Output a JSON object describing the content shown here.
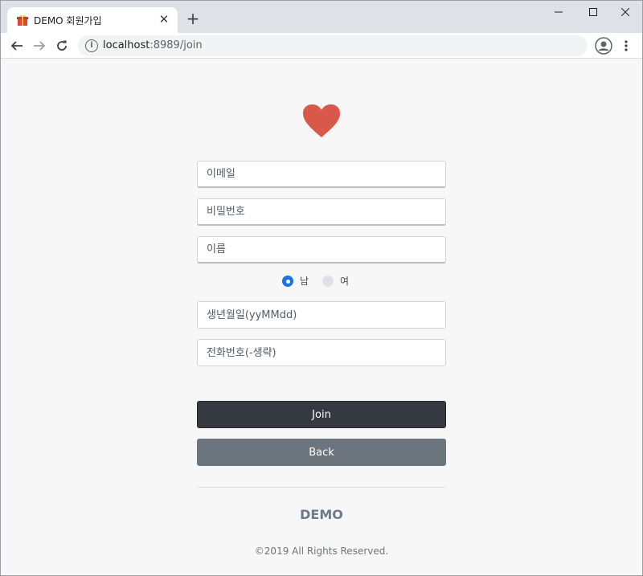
{
  "browser": {
    "tab_title": "DEMO 회원가입",
    "tab_close": "✕",
    "new_tab": "+",
    "url_host": "localhost",
    "url_rest": ":8989/join",
    "icons": [
      "gift-favicon-icon",
      "close-icon",
      "plus-icon",
      "minimize-icon",
      "maximize-icon",
      "close-window-icon",
      "back-arrow-icon",
      "forward-arrow-icon",
      "reload-icon",
      "info-icon",
      "profile-icon",
      "more-menu-icon"
    ]
  },
  "form": {
    "email_placeholder": "이메일",
    "password_placeholder": "비밀번호",
    "name_placeholder": "이름",
    "gender_male": "남",
    "gender_female": "여",
    "gender_selected": "남",
    "birthdate_placeholder": "생년월일(yyMMdd)",
    "phone_placeholder": "전화번호(-생략)",
    "join_label": "Join",
    "back_label": "Back"
  },
  "footer": {
    "brand": "DEMO",
    "copyright": "©2019 All Rights Reserved."
  },
  "colors": {
    "heart": "#d9584a",
    "join_button": "#343a40",
    "back_button": "#6c757d",
    "radio_checked": "#1a73e8",
    "page_background": "#f7f7f7"
  }
}
